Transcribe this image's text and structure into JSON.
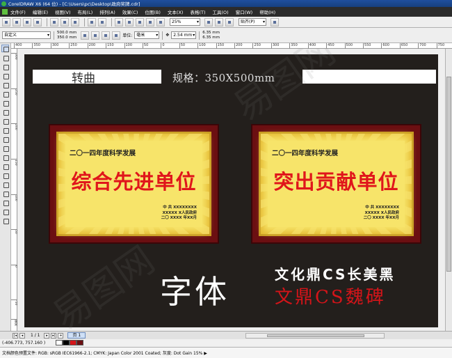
{
  "window": {
    "title": "CorelDRAW X6 (64 位) - [C:\\Users\\pc\\Desktop\\政府奖牌.cdr]"
  },
  "menu": {
    "items": [
      "文件(F)",
      "编辑(E)",
      "视图(V)",
      "布局(L)",
      "排列(A)",
      "效果(C)",
      "位图(B)",
      "文本(X)",
      "表格(T)",
      "工具(O)",
      "窗口(W)",
      "帮助(H)"
    ]
  },
  "toolbar1": {
    "zoom_value": "25%",
    "snap_label": "贴齐(P)"
  },
  "toolbar2": {
    "preset_value": "自定义",
    "width_value": "500.0 mm",
    "height_value": "350.0 mm",
    "units_label": "单位:",
    "units_value": "毫米",
    "nudge_value": "2.54 mm",
    "dup_x_value": "6.35 mm",
    "dup_y_value": "6.35 mm"
  },
  "ruler": {
    "h_ticks": [
      "400",
      "350",
      "300",
      "250",
      "200",
      "150",
      "100",
      "50",
      "0",
      "50",
      "100",
      "150",
      "200",
      "250",
      "300",
      "350",
      "400",
      "450",
      "500",
      "550",
      "600",
      "650",
      "700",
      "750"
    ],
    "v_ticks": [
      "300",
      "250",
      "200",
      "150",
      "100",
      "50",
      "0",
      "-50"
    ],
    "unit_label": "毫米"
  },
  "canvas": {
    "label_curve": "转曲",
    "spec_text": "规格：350X500mm",
    "plaques": [
      {
        "year_line": "二〇一四年度科学发展",
        "award": "综合先进单位",
        "sign_lines": [
          "中 共  XXXXXXXX",
          "XXXXX X人民政府",
          "二〇 XXXX 年XX月"
        ]
      },
      {
        "year_line": "二〇一四年度科学发展",
        "award": "突出贡献单位",
        "sign_lines": [
          "中 共  XXXXXXXX",
          "XXXXX X人民政府",
          "二〇 XXXX 年XX月"
        ]
      }
    ],
    "font_heading": "字体",
    "font_sample_1": "文化鼎CS长美黑",
    "font_sample_2": "文鼎CS魏碑",
    "watermark": "易图网"
  },
  "pagebar": {
    "page_count": "1 / 1",
    "page_tab": "页 1"
  },
  "coords": {
    "readout": "(-406.773, 757.160 )"
  },
  "status": {
    "text": "文档颜色预置文件: RGB: sRGB IEC61966-2.1; CMYK: Japan Color 2001 Coated; 灰度: Dot Gain 15% ▶"
  },
  "colors": {
    "artboard": "#231f1c",
    "plaque_border": "#6b0f12",
    "plaque_gold": "#f7e46a",
    "award_red": "#e0161b",
    "swatch_red": "#d41419",
    "swatch_dark": "#6b0f12"
  }
}
